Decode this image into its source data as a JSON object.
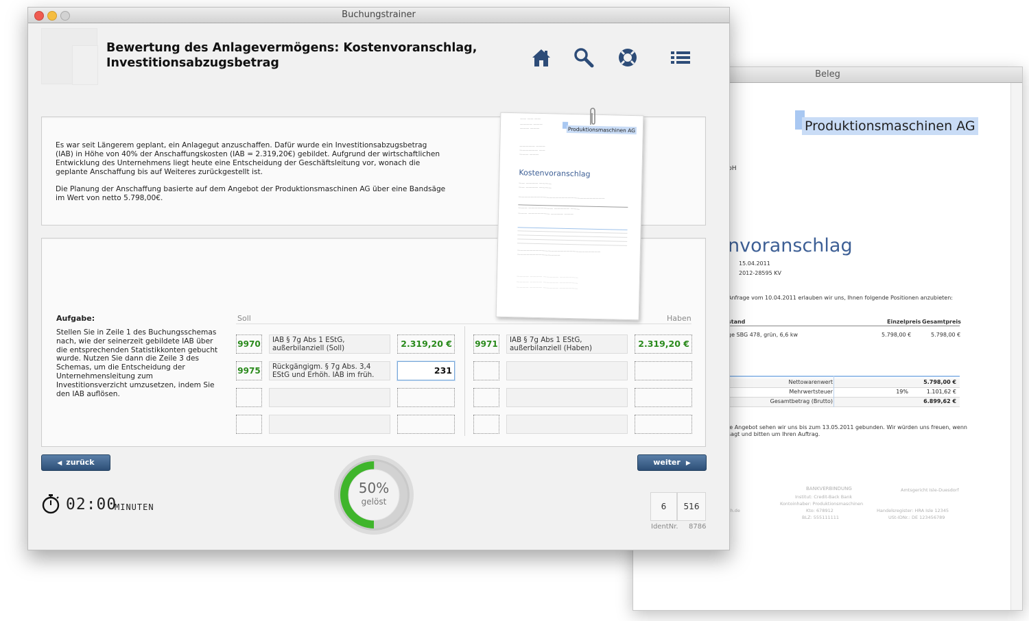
{
  "main_window": {
    "title": "Buchungstrainer",
    "heading_line1": "Bewertung des Anlagevermögens: Kostenvoranschlag,",
    "heading_line2": "Investitionsabzugsbetrag",
    "toolbar_icons": [
      "home-icon",
      "search-icon",
      "help-lifebuoy-icon",
      "list-icon"
    ],
    "description_p1": "Es war seit Längerem geplant, ein Anlagegut anzuschaffen. Dafür wurde ein Investitionsabzugsbetrag (IAB) in Höhe von 40% der Anschaffungskosten (IAB = 2.319,20€) gebildet. Aufgrund der wirtschaftlichen Entwicklung des Unternehmens liegt heute eine Entscheidung der Geschäftsleitung vor, wonach die geplante Anschaffung bis auf Weiteres zurückgestellt ist.",
    "description_p2": "Die Planung der Anschaffung basierte auf dem Angebot der Produktionsmaschinen AG über eine Bandsäge im Wert von netto 5.798,00€.",
    "task_heading": "Aufgabe:",
    "task_text": "Stellen Sie in Zeile 1 des Buchungsschemas nach, wie der seinerzeit gebildete IAB über die entsprechenden Statistikkonten gebucht wurde. Nutzen Sie dann die Zeile 3 des Schemas, um die Entscheidung der Unternehmensleitung zum Investitionsverzicht umzusetzen, indem Sie den IAB auflösen.",
    "soll_label": "Soll",
    "haben_label": "Haben",
    "rows": [
      {
        "soll_account": "9970",
        "soll_text": "IAB § 7g Abs 1 EStG, außerbilanziell (Soll)",
        "soll_amount": "2.319,20 €",
        "haben_account": "9971",
        "haben_text": "IAB § 7g Abs 1 EStG, außerbilanziell (Haben)",
        "haben_amount": "2.319,20 €"
      },
      {
        "soll_account": "9975",
        "soll_text": "Rückgängigm. § 7g Abs. 3,4 EStG und Erhöh. IAB im früh.",
        "soll_amount": "231",
        "haben_account": "",
        "haben_text": "",
        "haben_amount": ""
      },
      {
        "soll_account": "",
        "soll_text": "",
        "soll_amount": "",
        "haben_account": "",
        "haben_text": "",
        "haben_amount": ""
      },
      {
        "soll_account": "",
        "soll_text": "",
        "soll_amount": "",
        "haben_account": "",
        "haben_text": "",
        "haben_amount": ""
      }
    ],
    "back_button": "zurück",
    "next_button": "weiter",
    "timer_value": "02:00",
    "timer_unit": "MINUTEN",
    "progress_percent": "50%",
    "progress_fraction": 0.5,
    "progress_label": "gelöst",
    "counter_left": "6",
    "counter_right": "516",
    "ident_label": "IdentNr.",
    "ident_value": "8786",
    "colors": {
      "accent_green": "#2a8a1c",
      "progress_green": "#3fb52b",
      "nav_blue": "#2d4f77"
    }
  },
  "thumbnail": {
    "company": "Produktionsmaschinen AG",
    "doc_title": "Kostenvoranschlag"
  },
  "beleg_window": {
    "title": "Beleg",
    "company": "Produktionsmaschinen AG",
    "recipient_fragment": "bH",
    "title_fragment": "nvoranschlag",
    "date": "15.04.2011",
    "reference": "2012-28595 KV",
    "intro": "Anfrage vom 10.04.2011 erlauben wir uns, Ihnen folgende Positionen anzubieten:",
    "table_header_fragment": "stand",
    "col_unit_price": "Einzelpreis",
    "col_total_price": "Gesamtpreis",
    "item": "ge SBG 478, grün, 6,6 kw",
    "item_unit_price": "5.798,00 €",
    "item_total_price": "5.798,00 €",
    "net_label": "Nettowarenwert",
    "net_value": "5.798,00 €",
    "vat_label": "Mehrwertsteuer",
    "vat_rate": "19%",
    "vat_value": "1.101,62 €",
    "gross_label": "Gesamtbetrag (Brutto)",
    "gross_value": "6.899,62 €",
    "closing_line1": "le Angebot sehen wir uns bis zum 13.05.2011 gebunden. Wir würden uns freuen, wenn",
    "closing_line2": "sagt und bitten um Ihren Auftrag.",
    "footer_bank_heading": "BANKVERBINDUNG",
    "footer_bank_institute": "Institut: Credit-Back Bank",
    "footer_bank_holder": "Kontoinhaber: Produktionsmaschinen",
    "footer_bank_account": "Kto: 678912",
    "footer_bank_blz": "BLZ: 555111111",
    "footer_court": "Amtsgericht Isle-Duesdorf",
    "footer_register": "Handelsregister: HRA Isle 12345",
    "footer_vat_id": "USt-IDNr.: DE 123456789",
    "footer_left_fragment": "ch.de"
  }
}
